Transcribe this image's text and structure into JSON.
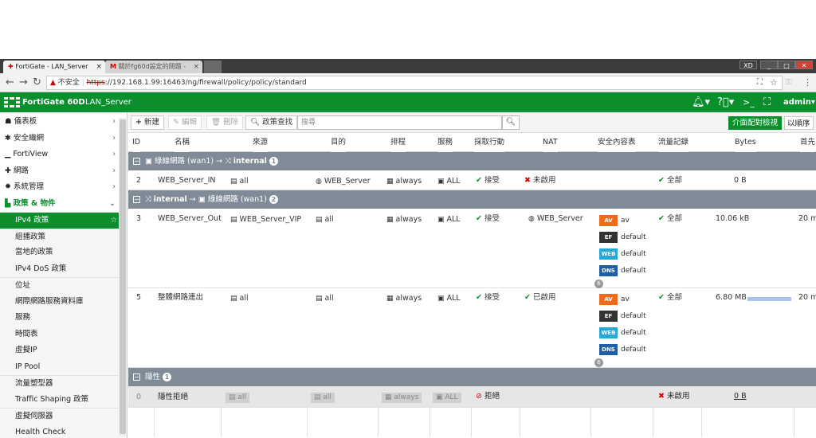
{
  "browser": {
    "tabs": [
      {
        "title": "FortiGate - LAN_Server"
      },
      {
        "title": "關於fg60d設定的問題 -"
      }
    ],
    "url_warning": "不安全",
    "url_scheme": "https",
    "url_rest": "://192.168.1.99:16463/ng/firewall/policy/policy/standard",
    "window_buttons": [
      "XD",
      "_",
      "□",
      "✕"
    ]
  },
  "app": {
    "brand": "FortiGate 60D",
    "hostname": "LAN_Server",
    "user": "admin"
  },
  "sidebar": {
    "items": [
      {
        "label": "儀表板",
        "icon": "dashboard-icon",
        "chevron": "›"
      },
      {
        "label": "安全織網",
        "icon": "security-fabric-icon",
        "chevron": "›"
      },
      {
        "label": "FortiView",
        "icon": "fortiview-icon",
        "chevron": "›"
      },
      {
        "label": "網路",
        "icon": "network-icon",
        "chevron": "›"
      },
      {
        "label": "系統管理",
        "icon": "gear-icon",
        "chevron": "›"
      },
      {
        "label": "政策 & 物件",
        "icon": "policy-icon",
        "chevron": "⌄"
      }
    ],
    "subitems": [
      "IPv4 政策",
      "組播政策",
      "當地的政策",
      "IPv4 DoS 政策",
      "位址",
      "網際網路服務資料庫",
      "服務",
      "時間表",
      "虛擬IP",
      "IP Pool",
      "流量塑型器",
      "Traffic Shaping 政策",
      "虛擬伺服器",
      "Health Check"
    ]
  },
  "toolbar": {
    "new": "新建",
    "edit": "編輯",
    "delete": "刪除",
    "policy_lookup": "政策查找",
    "search_placeholder": "搜尋",
    "interface_pair_view": "介面配對檢視",
    "by_sequence": "以順序"
  },
  "table": {
    "headers": [
      "ID",
      "名稱",
      "來源",
      "目的",
      "排程",
      "服務",
      "採取行動",
      "NAT",
      "安全內容表",
      "流量記錄",
      "Bytes",
      "首先"
    ],
    "groups": [
      {
        "from": "綠線網路 (wan1)",
        "arrow": "→",
        "to": "internal",
        "count": "1"
      },
      {
        "from": "internal",
        "arrow": "→",
        "to": "綠線網路 (wan1)",
        "count": "2"
      },
      {
        "label": "隱性",
        "count": "1"
      }
    ],
    "rows": [
      {
        "id": "2",
        "name": "WEB_Server_IN",
        "source": "all",
        "destination": "WEB_Server",
        "schedule": "always",
        "service": "ALL",
        "action": "接受",
        "nat": "未啟用",
        "profiles": [],
        "log": "全部",
        "bytes": "0 B",
        "first": ""
      },
      {
        "id": "3",
        "name": "WEB_Server_Out",
        "source": "WEB_Server_VIP",
        "destination": "all",
        "schedule": "always",
        "service": "ALL",
        "action": "接受",
        "nat": "WEB_Server",
        "profiles": [
          {
            "tag": "AV",
            "name": "av"
          },
          {
            "tag": "EF",
            "name": "default"
          },
          {
            "tag": "WEB",
            "name": "default"
          },
          {
            "tag": "DNS",
            "name": "default"
          }
        ],
        "more": "6",
        "log": "全部",
        "bytes": "10.06 kB",
        "first": "20 m"
      },
      {
        "id": "5",
        "name": "整體網路連出",
        "source": "all",
        "destination": "all",
        "schedule": "always",
        "service": "ALL",
        "action": "接受",
        "nat": "已啟用",
        "profiles": [
          {
            "tag": "AV",
            "name": "av"
          },
          {
            "tag": "EF",
            "name": "default"
          },
          {
            "tag": "WEB",
            "name": "default"
          },
          {
            "tag": "DNS",
            "name": "default"
          }
        ],
        "more": "6",
        "log": "全部",
        "bytes": "6.80 MB",
        "usage": 0.95,
        "first": "20 m"
      },
      {
        "id": "0",
        "name": "隱性拒絕",
        "source": "all",
        "destination": "all",
        "schedule": "always",
        "service": "ALL",
        "action": "拒絕",
        "nat": "",
        "profiles": [],
        "log": "未啟用",
        "bytes": "0 B",
        "first": ""
      }
    ]
  }
}
